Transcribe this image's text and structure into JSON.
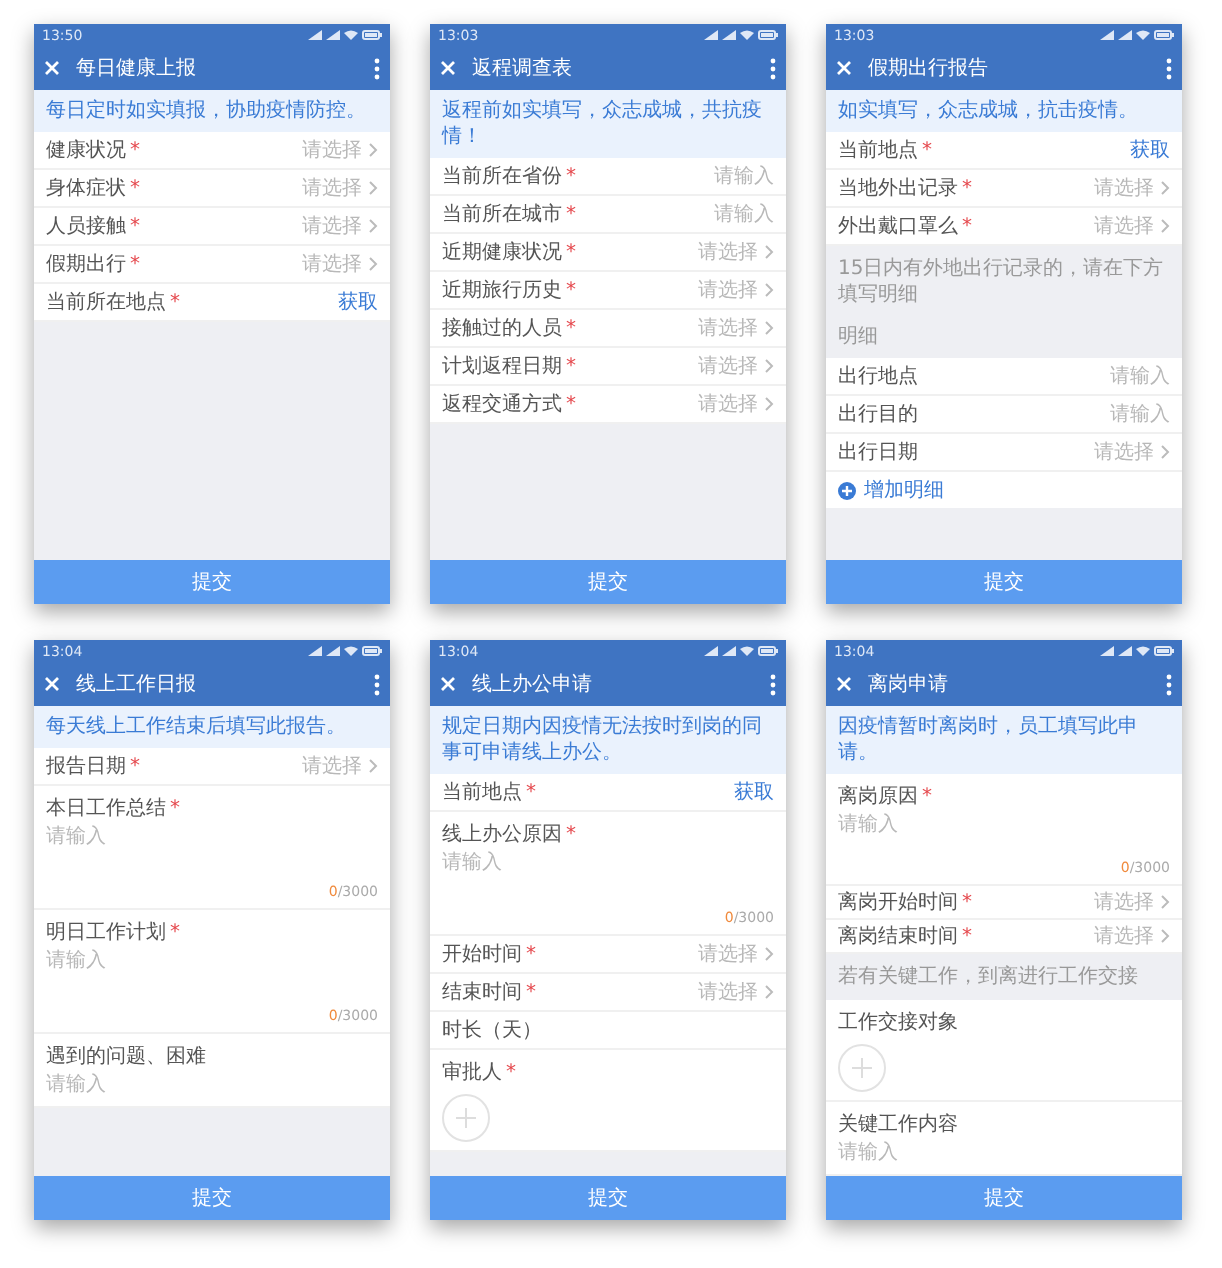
{
  "screens": [
    {
      "time": "13:50",
      "title": "每日健康上报",
      "notice": "每日定时如实填报，协助疫情防控。",
      "items": [
        {
          "kind": "select",
          "label": "健康状况",
          "asterisk": "*",
          "placeholder": "请选择"
        },
        {
          "kind": "select",
          "label": "身体症状",
          "asterisk": "*",
          "placeholder": "请选择"
        },
        {
          "kind": "select",
          "label": "人员接触",
          "asterisk": "*",
          "placeholder": "请选择"
        },
        {
          "kind": "select",
          "label": "假期出行",
          "asterisk": "*",
          "placeholder": "请选择"
        },
        {
          "kind": "locate",
          "label": "当前所在地点",
          "asterisk": "*",
          "action": "获取"
        }
      ],
      "submit": "提交"
    },
    {
      "time": "13:03",
      "title": "返程调查表",
      "notice": "返程前如实填写，众志成城，共抗疫情！",
      "items": [
        {
          "kind": "input",
          "label": "当前所在省份",
          "asterisk": "*",
          "placeholder": "请输入"
        },
        {
          "kind": "input",
          "label": "当前所在城市",
          "asterisk": "*",
          "placeholder": "请输入"
        },
        {
          "kind": "select",
          "label": "近期健康状况",
          "asterisk": "*",
          "placeholder": "请选择"
        },
        {
          "kind": "select",
          "label": "近期旅行历史",
          "asterisk": "*",
          "placeholder": "请选择"
        },
        {
          "kind": "select",
          "label": "接触过的人员",
          "asterisk": "*",
          "placeholder": "请选择"
        },
        {
          "kind": "select",
          "label": "计划返程日期",
          "asterisk": "*",
          "placeholder": "请选择"
        },
        {
          "kind": "select",
          "label": "返程交通方式",
          "asterisk": "*",
          "placeholder": "请选择"
        }
      ],
      "submit": "提交"
    },
    {
      "time": "13:03",
      "title": "假期出行报告",
      "notice": "如实填写，众志成城，抗击疫情。",
      "items": [
        {
          "kind": "locate",
          "label": "当前地点",
          "asterisk": "*",
          "action": "获取"
        },
        {
          "kind": "select",
          "label": "当地外出记录",
          "asterisk": "*",
          "placeholder": "请选择"
        },
        {
          "kind": "select",
          "label": "外出戴口罩么",
          "asterisk": "*",
          "placeholder": "请选择"
        },
        {
          "kind": "note",
          "text": "15日内有外地出行记录的，请在下方填写明细"
        },
        {
          "kind": "subheader",
          "text": "明细"
        },
        {
          "kind": "input",
          "label": "出行地点",
          "placeholder": "请输入"
        },
        {
          "kind": "input",
          "label": "出行目的",
          "placeholder": "请输入"
        },
        {
          "kind": "select",
          "label": "出行日期",
          "placeholder": "请选择"
        },
        {
          "kind": "add",
          "text": "增加明细"
        }
      ],
      "submit": "提交"
    },
    {
      "time": "13:04",
      "title": "线上工作日报",
      "notice": "每天线上工作结束后填写此报告。",
      "items": [
        {
          "kind": "select",
          "label": "报告日期",
          "asterisk": "*",
          "placeholder": "请选择"
        },
        {
          "kind": "textarea",
          "label": "本日工作总结",
          "asterisk": "*",
          "placeholder": "请输入",
          "count": "0",
          "limit": "/3000"
        },
        {
          "kind": "textarea",
          "label": "明日工作计划",
          "asterisk": "*",
          "placeholder": "请输入",
          "count": "0",
          "limit": "/3000"
        },
        {
          "kind": "textarea",
          "label": "遇到的问题、困难",
          "placeholder": "请输入"
        }
      ],
      "submit": "提交"
    },
    {
      "time": "13:04",
      "title": "线上办公申请",
      "notice": "规定日期内因疫情无法按时到岗的同事可申请线上办公。",
      "items": [
        {
          "kind": "locate",
          "label": "当前地点",
          "asterisk": "*",
          "action": "获取"
        },
        {
          "kind": "textarea",
          "label": "线上办公原因",
          "asterisk": "*",
          "placeholder": "请输入",
          "count": "0",
          "limit": "/3000"
        },
        {
          "kind": "select",
          "label": "开始时间",
          "asterisk": "*",
          "placeholder": "请选择"
        },
        {
          "kind": "select",
          "label": "结束时间",
          "asterisk": "*",
          "placeholder": "请选择"
        },
        {
          "kind": "plain",
          "label": "时长（天）"
        },
        {
          "kind": "people",
          "label": "审批人",
          "asterisk": "*"
        }
      ],
      "submit": "提交"
    },
    {
      "time": "13:04",
      "title": "离岗申请",
      "notice": "因疫情暂时离岗时，员工填写此申请。",
      "items": [
        {
          "kind": "textarea",
          "label": "离岗原因",
          "asterisk": "*",
          "placeholder": "请输入",
          "count": "0",
          "limit": "/3000"
        },
        {
          "kind": "select",
          "label": "离岗开始时间",
          "asterisk": "*",
          "placeholder": "请选择"
        },
        {
          "kind": "select",
          "label": "离岗结束时间",
          "asterisk": "*",
          "placeholder": "请选择"
        },
        {
          "kind": "note",
          "text": "若有关键工作，到离进行工作交接"
        },
        {
          "kind": "people",
          "label": "工作交接对象"
        },
        {
          "kind": "textarea",
          "label": "关键工作内容",
          "placeholder": "请输入"
        }
      ],
      "submit": "提交"
    }
  ]
}
